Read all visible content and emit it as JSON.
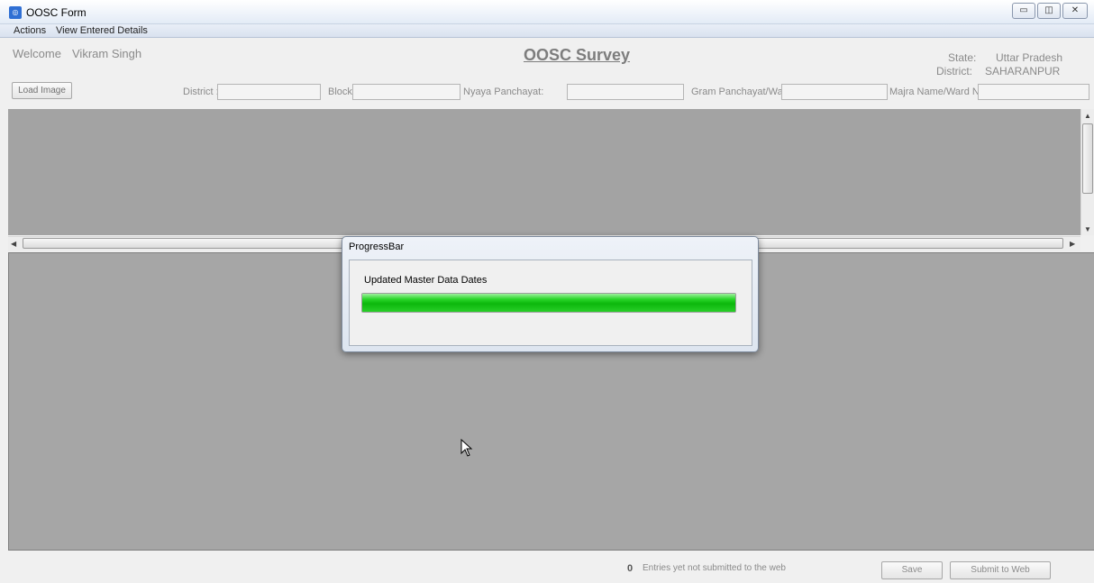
{
  "window": {
    "title": "OOSC Form",
    "app_icon": "app-logo-icon",
    "controls": {
      "minimize": "minimize-icon",
      "maximize": "restore-icon",
      "close": "close-icon"
    }
  },
  "menu": {
    "items": [
      {
        "label": "Actions"
      },
      {
        "label": "View Entered Details"
      }
    ]
  },
  "header": {
    "welcome_label": "Welcome",
    "user_name": "Vikram Singh",
    "survey_title": "OOSC Survey",
    "state_label": "State:",
    "state_value": "Uttar Pradesh",
    "district_label": "District:",
    "district_value": "SAHARANPUR"
  },
  "filters": {
    "load_image_label": "Load Image",
    "district_label": "District :",
    "district_value": "",
    "block_label": "Block:",
    "block_value": "",
    "nyaya_label": "Nyaya Panchayat:",
    "nyaya_value": "",
    "gram_label": "Gram Panchayat/Ward:",
    "gram_value": "",
    "majra_label": "Majra Name/Ward No.:",
    "majra_value": ""
  },
  "dialog": {
    "title": "ProgressBar",
    "message": "Updated Master Data Dates",
    "progress_fraction": 1.0,
    "progress_color": "#1ccc1c"
  },
  "footer": {
    "entries_count": "0",
    "entries_text": "Entries yet not submitted to the web",
    "save_label": "Save",
    "submit_label": "Submit to Web"
  },
  "colors": {
    "panel_gray": "#a6a6a6",
    "label_gray": "#8a8a8a"
  }
}
